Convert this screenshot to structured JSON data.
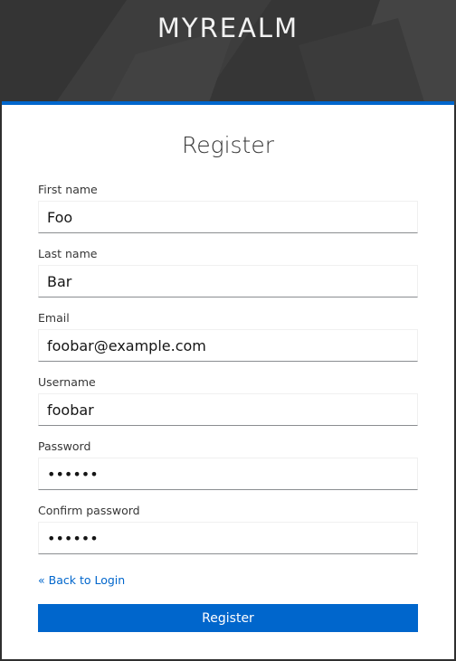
{
  "header": {
    "realm_name": "MYREALM"
  },
  "form": {
    "title": "Register",
    "fields": [
      {
        "label": "First name",
        "value": "Foo",
        "type": "text"
      },
      {
        "label": "Last name",
        "value": "Bar",
        "type": "text"
      },
      {
        "label": "Email",
        "value": "foobar@example.com",
        "type": "text"
      },
      {
        "label": "Username",
        "value": "foobar",
        "type": "text"
      },
      {
        "label": "Password",
        "value": "••••••",
        "type": "password"
      },
      {
        "label": "Confirm password",
        "value": "••••••",
        "type": "password"
      }
    ],
    "back_link": "« Back to Login",
    "submit_label": "Register"
  },
  "colors": {
    "accent": "#0066cc",
    "header_bg": "#3a3a3a",
    "card_bg": "#ffffff"
  }
}
